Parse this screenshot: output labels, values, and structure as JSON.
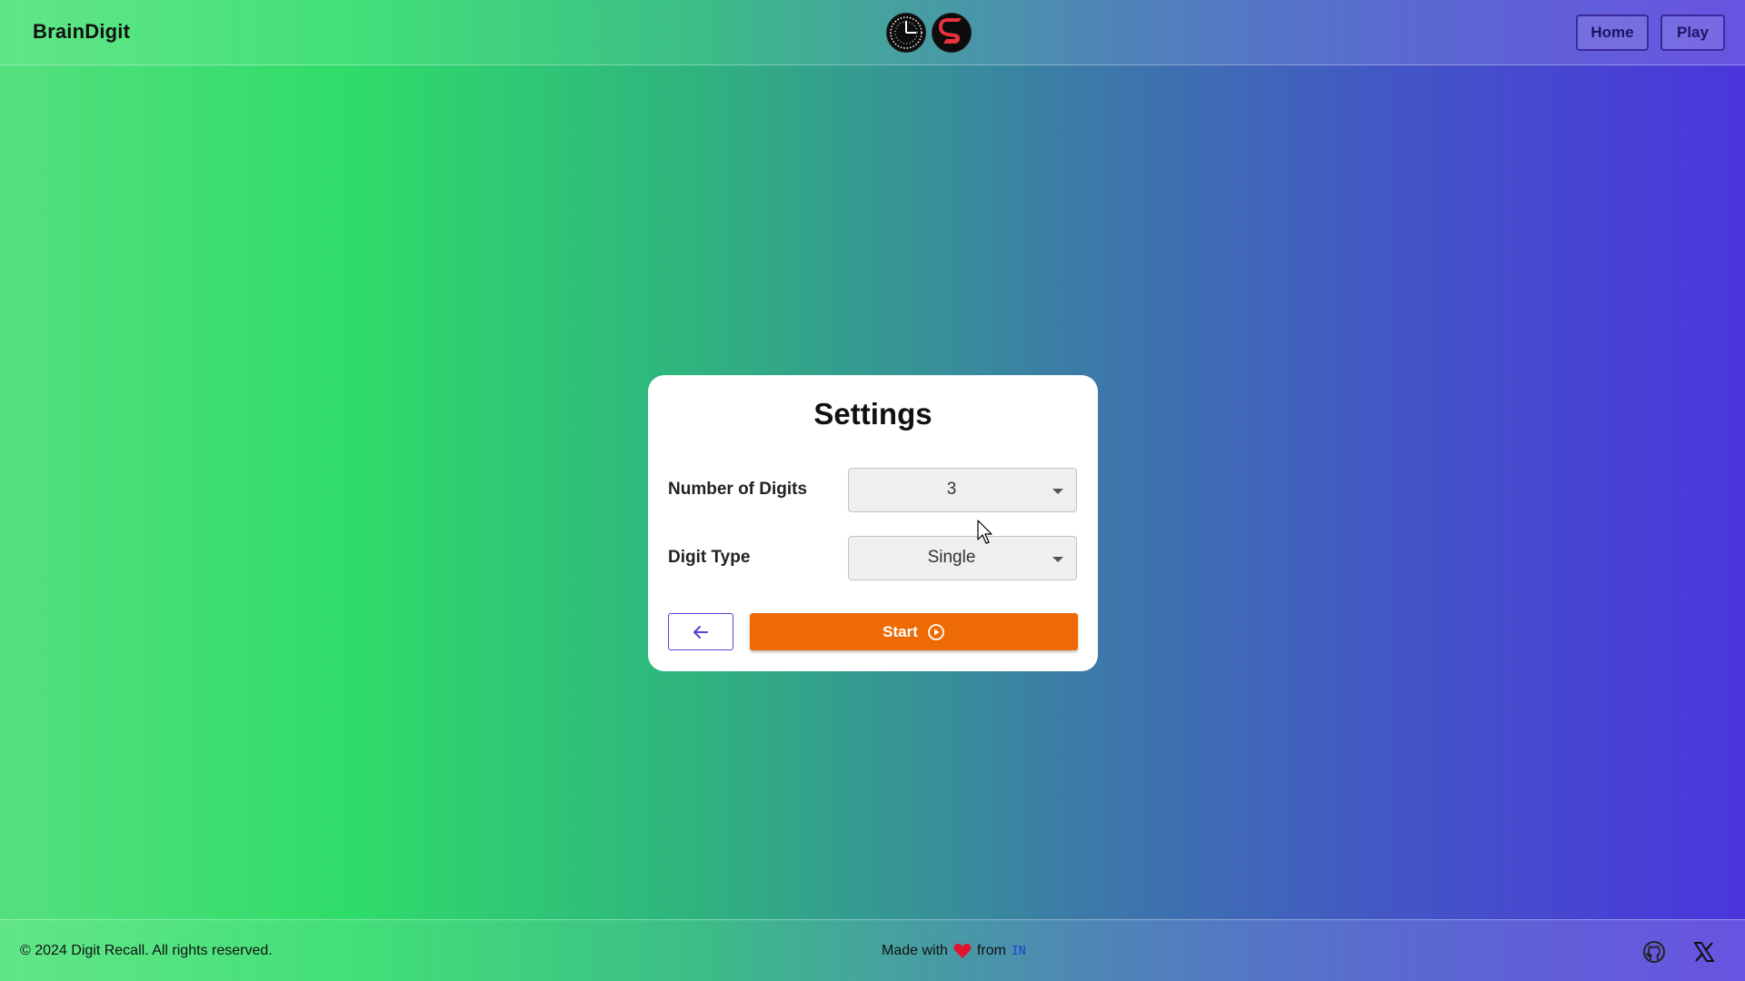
{
  "navbar": {
    "brand": "BrainDigit",
    "logos": [
      "clock-logo-icon",
      "s-logo-icon"
    ],
    "links": {
      "home_label": "Home",
      "play_label": "Play"
    }
  },
  "settings": {
    "title": "Settings",
    "fields": {
      "digits": {
        "label": "Number of Digits",
        "value": "3"
      },
      "type": {
        "label": "Digit Type",
        "value": "Single"
      }
    },
    "back_button_icon": "arrow-left-icon",
    "start_label": "Start",
    "start_icon": "play-circle-icon"
  },
  "footer": {
    "copyright": "© 2024 Digit Recall. All rights reserved.",
    "made_with_prefix": "Made with",
    "made_with_suffix": "from",
    "country": "IN",
    "social_icons": [
      "github-icon",
      "x-icon"
    ]
  },
  "colors": {
    "start_button": "#ee6a05",
    "accent_purple": "#5b3fd6",
    "heart": "#e0142c",
    "gradient_left": "#2fdc69",
    "gradient_right": "#4a36dc"
  }
}
